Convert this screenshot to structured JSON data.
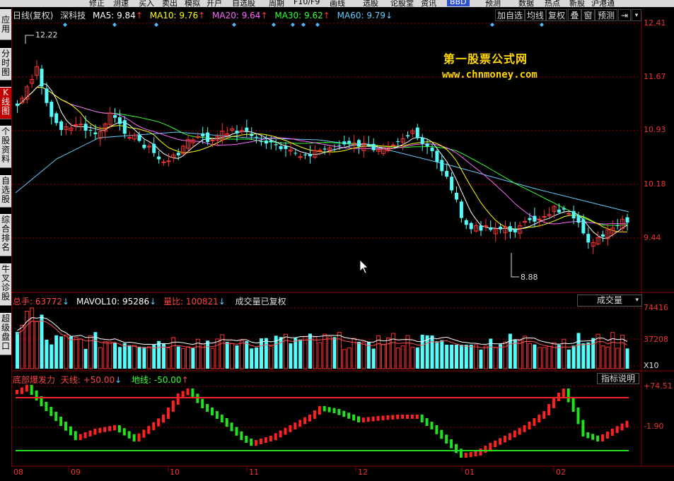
{
  "toolbar": {
    "items": [
      "修正",
      "测速",
      "买入",
      "卖出",
      "模拟",
      "开户",
      "自选股",
      "周期",
      "F10/F9",
      "画线",
      "选股",
      "论股堂",
      "资讯",
      "预测",
      "数据",
      "热点",
      "新股",
      "沪港通"
    ],
    "badge": "BBD"
  },
  "sidebar": {
    "tabs": [
      "应用",
      "分时图",
      "K线图",
      "个股资料",
      "自选股",
      "综合排名",
      "牛叉诊股",
      "超级盘口"
    ],
    "active_index": 2
  },
  "price_panel": {
    "title": "日线(复权)",
    "stock": "深科技",
    "ma": [
      {
        "label": "MA5: 9.84",
        "arrow": "↑",
        "color": "#ffffff"
      },
      {
        "label": "MA10: 9.76",
        "arrow": "↑",
        "color": "#ffff00"
      },
      {
        "label": "MA20: 9.64",
        "arrow": "↑",
        "color": "#ff66ff"
      },
      {
        "label": "MA30: 9.62",
        "arrow": "↑",
        "color": "#33ff33"
      },
      {
        "label": "MA60: 9.79",
        "arrow": "↓",
        "color": "#66ccff"
      }
    ],
    "buttons": [
      "加自选",
      "均线",
      "复权",
      "叠",
      "窗",
      "预测",
      "⇥",
      "▾"
    ],
    "price_labels": [
      "12.41",
      "11.67",
      "10.93",
      "10.18",
      "9.44"
    ],
    "high_label": "12.22",
    "low_label": "8.88",
    "watermark_line1": "第一股票公式网",
    "watermark_line2": "www.chnmoney.com"
  },
  "volume_panel": {
    "total_label": "总手: 63772",
    "total_arrow": "↓",
    "mavol_label": "MAVOL10: 95286",
    "mavol_arrow": "↓",
    "ratio_label": "量比: 100821",
    "ratio_arrow": "↓",
    "note": "成交量已复权",
    "selector": "成交量",
    "selector_arrow": "▾",
    "scale_labels": [
      "74416",
      "37208"
    ],
    "unit": "X10"
  },
  "indicator_panel": {
    "name": "底部爆发力",
    "sky_label": "天线: +50.00",
    "sky_arrow": "↓",
    "ground_label": "地线: -50.00",
    "ground_arrow": "↑",
    "help_button": "指标说明",
    "scale_labels": [
      "+74.51",
      "-1.90"
    ]
  },
  "date_axis": [
    "08",
    "09",
    "10",
    "11",
    "12",
    "01",
    "02"
  ],
  "colors": {
    "up": "#ff3232",
    "down": "#54fcfc",
    "grid": "#8b0000",
    "sky_line": "#ff2020",
    "ground_line": "#20e020"
  }
}
